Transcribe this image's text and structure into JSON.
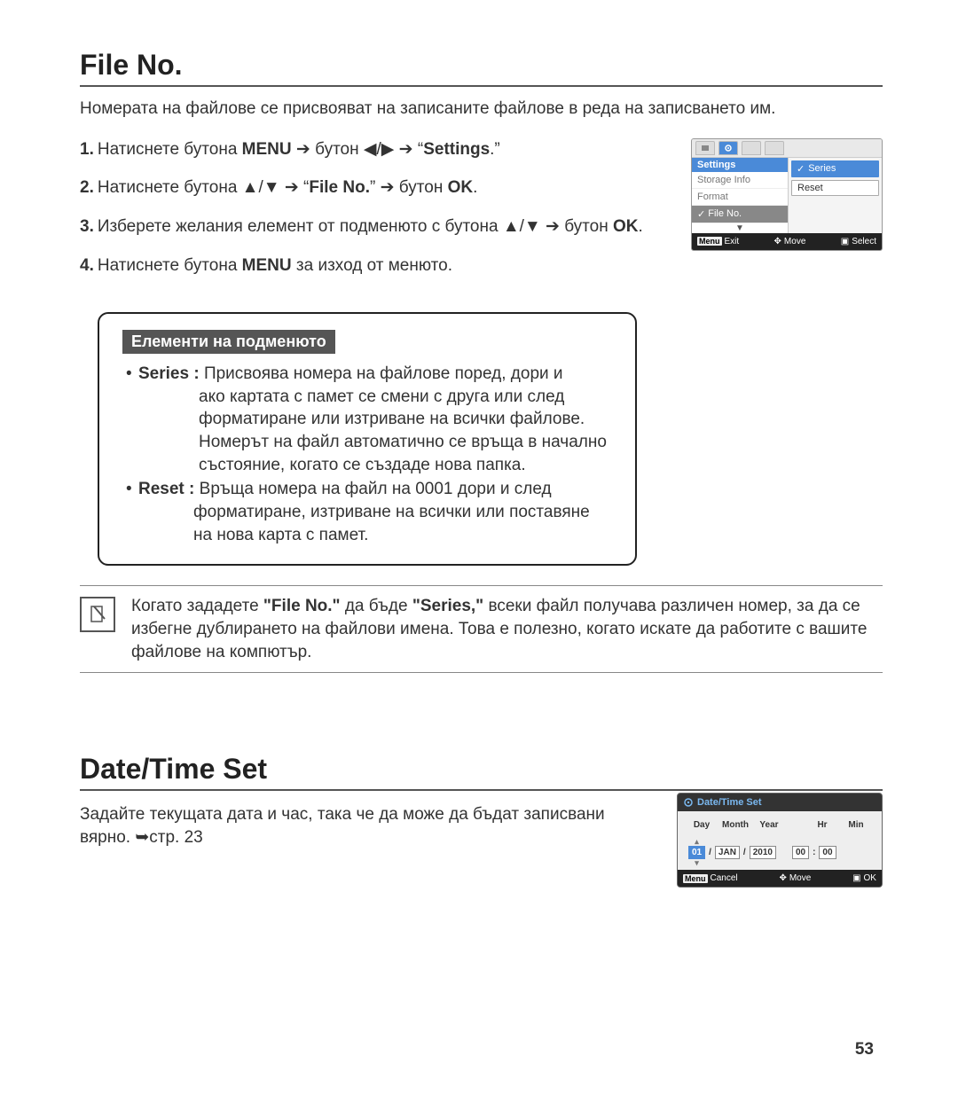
{
  "section1": {
    "title": "File No.",
    "intro": "Номерата на файлове се присвояват на записаните файлове в реда на записването им.",
    "step1_a": "Натиснете бутона ",
    "step1_menu": "MENU",
    "step1_b": " ➔ бутон ◀/▶ ➔ “",
    "step1_settings": "Settings",
    "step1_c": ".”",
    "step2_a": "Натиснете бутона ▲/▼ ➔ “",
    "step2_fileno": "File No.",
    "step2_b": "” ➔ бутон ",
    "step2_ok": "OK",
    "step2_c": ".",
    "step3_a": "Изберете желания елемент от подменюто с бутона ▲/▼ ➔ бутон ",
    "step3_ok": "OK",
    "step3_b": ".",
    "step4_a": "Натиснете бутона ",
    "step4_menu": "MENU",
    "step4_b": " за изход от менюто.",
    "callout_title": "Елементи на подменюто",
    "series_label": "Series : ",
    "series_line1": "Присвоява номера на файлове поред, дори и",
    "series_rest": "ако картата с памет се смени с друга или след форматиране или изтриване на всички файлове. Номерът на файл автоматично се връща в начално състояние, когато се създаде нова папка.",
    "reset_label": "Reset : ",
    "reset_line1": "Връща номера на файл на 0001 дори и след",
    "reset_rest": "форматиране, изтриване на всички или поставяне на нова карта с памет.",
    "note_a": "Когато зададете ",
    "note_fileno": "\"File No.\"",
    "note_b": " да бъде ",
    "note_series": "\"Series,\"",
    "note_c": " всеки файл получава различен номер, за да се избегне дублирането на файлови имена. Това е полезно, когато искате да работите с вашите файлове на компютър."
  },
  "screenshot1": {
    "header": "Settings",
    "items": [
      "Storage Info",
      "Format",
      "File No."
    ],
    "opt_series": "Series",
    "opt_reset": "Reset",
    "bottom_menu": "Menu",
    "bottom_exit": "Exit",
    "bottom_move": "Move",
    "bottom_select": "Select"
  },
  "section2": {
    "title": "Date/Time Set",
    "intro": "Задайте текущата дата и час, така че да може да бъдат записвани вярно. ➥стр. 23"
  },
  "screenshot2": {
    "title": "Date/Time Set",
    "lbl_day": "Day",
    "lbl_month": "Month",
    "lbl_year": "Year",
    "lbl_hr": "Hr",
    "lbl_min": "Min",
    "val_day": "01",
    "val_month": "JAN",
    "val_year": "2010",
    "val_hr": "00",
    "val_min": "00",
    "slash": "/",
    "colon": ":",
    "bottom_menu": "Menu",
    "bottom_cancel": "Cancel",
    "bottom_move": "Move",
    "bottom_ok": "OK"
  },
  "page_number": "53"
}
